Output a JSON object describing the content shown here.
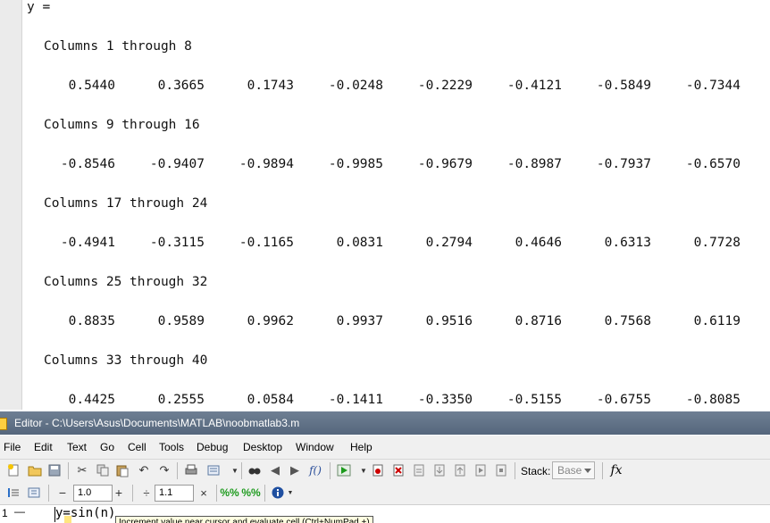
{
  "command_window": {
    "var_line": "y =",
    "blocks": [
      {
        "header": "Columns 1 through 8",
        "values": [
          "0.5440",
          "0.3665",
          "0.1743",
          "-0.0248",
          "-0.2229",
          "-0.4121",
          "-0.5849",
          "-0.7344"
        ]
      },
      {
        "header": "Columns 9 through 16",
        "values": [
          "-0.8546",
          "-0.9407",
          "-0.9894",
          "-0.9985",
          "-0.9679",
          "-0.8987",
          "-0.7937",
          "-0.6570"
        ]
      },
      {
        "header": "Columns 17 through 24",
        "values": [
          "-0.4941",
          "-0.3115",
          "-0.1165",
          "0.0831",
          "0.2794",
          "0.4646",
          "0.6313",
          "0.7728"
        ]
      },
      {
        "header": "Columns 25 through 32",
        "values": [
          "0.8835",
          "0.9589",
          "0.9962",
          "0.9937",
          "0.9516",
          "0.8716",
          "0.7568",
          "0.6119"
        ]
      },
      {
        "header": "Columns 33 through 40",
        "values": [
          "0.4425",
          "0.2555",
          "0.0584",
          "-0.1411",
          "-0.3350",
          "-0.5155",
          "-0.6755",
          "-0.8085"
        ]
      }
    ]
  },
  "editor": {
    "title": "Editor - C:\\Users\\Asus\\Documents\\MATLAB\\noobmatlab3.m",
    "menu": [
      "File",
      "Edit",
      "Text",
      "Go",
      "Cell",
      "Tools",
      "Debug",
      "Desktop",
      "Window",
      "Help"
    ],
    "toolbar": {
      "stack_label": "Stack:",
      "stack_value": "Base",
      "fx_label": "fx"
    },
    "cell_toolbar": {
      "minus": "−",
      "field1": "1.0",
      "plus": "+",
      "divide": "÷",
      "field2": "1.1",
      "times": "×"
    },
    "lines": [
      {
        "number": "1",
        "marker": "—",
        "code": "y=sin(n)"
      }
    ],
    "tooltip": "Increment value near cursor and evaluate cell (Ctrl+NumPad +)"
  },
  "colors": {
    "title_bar": "#5e6f85",
    "menu_bg": "#f0f0f0",
    "gutter": "#ebebeb"
  }
}
